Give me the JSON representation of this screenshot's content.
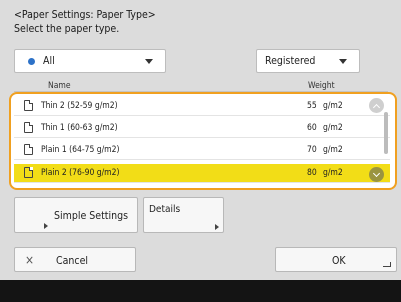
{
  "header": {
    "title": "<Paper Settings: Paper Type>",
    "instruction": "Select the paper type."
  },
  "filters": {
    "category": {
      "value": "All",
      "icon": "blue-dot-icon"
    },
    "source": {
      "value": "Registered"
    }
  },
  "columns": {
    "name": "Name",
    "weight": "Weight"
  },
  "paper_types": [
    {
      "name": "Thin 2 (52-59 g/m2)",
      "weight": "55",
      "unit": "g/m2",
      "selected": false
    },
    {
      "name": "Thin 1 (60-63 g/m2)",
      "weight": "60",
      "unit": "g/m2",
      "selected": false
    },
    {
      "name": "Plain 1 (64-75 g/m2)",
      "weight": "70",
      "unit": "g/m2",
      "selected": false
    },
    {
      "name": "Plain 2 (76-90 g/m2)",
      "weight": "80",
      "unit": "g/m2",
      "selected": true
    }
  ],
  "buttons": {
    "simple_settings": "Simple Settings",
    "details": "Details",
    "cancel": "Cancel",
    "cancel_icon": "×",
    "ok": "OK"
  },
  "colors": {
    "selection": "#f2dd17",
    "focus_border": "#f0a020",
    "accent_dot": "#2d72c8"
  }
}
